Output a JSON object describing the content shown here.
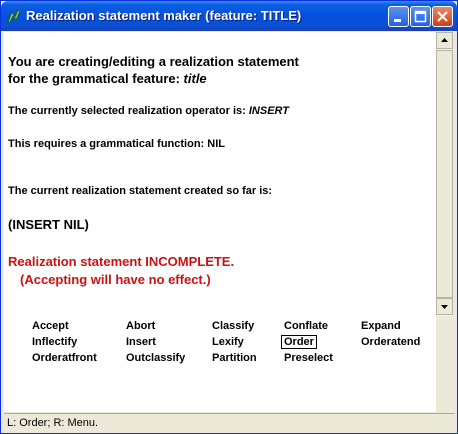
{
  "window": {
    "title": "Realization statement maker (feature: TITLE)"
  },
  "content": {
    "heading_line1": "You are creating/editing a realization statement",
    "heading_line2_prefix": "for the grammatical feature: ",
    "heading_feature": "title",
    "operator_prefix": "The currently selected realization operator is: ",
    "operator_value": "INSERT",
    "function_line": "This requires a grammatical function: NIL",
    "current_label": "The current realization statement created so far is:",
    "statement": "(INSERT NIL)",
    "incomplete": "Realization statement INCOMPLETE.",
    "no_effect": "(Accepting will have no effect.)"
  },
  "operations": {
    "row1": [
      "Accept",
      "Abort",
      "Classify",
      "Conflate",
      "Expand"
    ],
    "row2": [
      "Inflectify",
      "Insert",
      "Lexify",
      "Order",
      "Orderatend"
    ],
    "row3": [
      "Orderatfront",
      "Outclassify",
      "Partition",
      "Preselect"
    ],
    "selected": "Order"
  },
  "status": {
    "text": "L: Order; R: Menu."
  },
  "icons": {
    "app": "fountain-pen-icon",
    "minimize": "minimize-icon",
    "maximize": "maximize-icon",
    "close": "close-icon",
    "scroll_up": "arrow-up-icon",
    "scroll_down": "arrow-down-icon"
  },
  "colors": {
    "title_bar": "#0551dc",
    "error_text": "#cc1111"
  }
}
